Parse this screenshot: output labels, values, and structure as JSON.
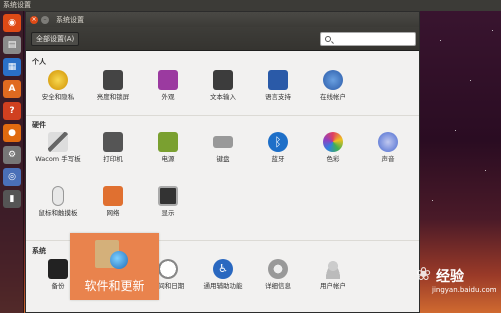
{
  "top_panel": {
    "title": "系统设置"
  },
  "window": {
    "title": "系统设置",
    "all_settings_label": "全部设置(A)",
    "search_placeholder": ""
  },
  "sections": [
    {
      "title": "个人",
      "items": [
        {
          "label": "安全和隐私",
          "icon": "privacy-icon",
          "color": "#f0c020"
        },
        {
          "label": "亮度和锁屏",
          "icon": "lock-icon",
          "color": "#444444"
        },
        {
          "label": "外观",
          "icon": "appearance-icon",
          "color": "#9b3aa0"
        },
        {
          "label": "文本输入",
          "icon": "keyboard-input-icon",
          "color": "#3c3c3c"
        },
        {
          "label": "语言支持",
          "icon": "language-flag-icon",
          "color": "#2a5aa8"
        },
        {
          "label": "在线帐户",
          "icon": "online-accounts-icon",
          "color": "#3c6eb4"
        }
      ]
    },
    {
      "title": "硬件",
      "items": [
        {
          "label": "Wacom 手写板",
          "icon": "wacom-pen-icon",
          "color": "#666666"
        },
        {
          "label": "打印机",
          "icon": "printer-icon",
          "color": "#555555"
        },
        {
          "label": "电源",
          "icon": "power-icon",
          "color": "#7aa030"
        },
        {
          "label": "键盘",
          "icon": "keyboard-icon",
          "color": "#888888"
        },
        {
          "label": "蓝牙",
          "icon": "bluetooth-icon",
          "color": "#1e6fc8"
        },
        {
          "label": "色彩",
          "icon": "color-icon",
          "color": "#e04060"
        },
        {
          "label": "声音",
          "icon": "sound-icon",
          "color": "#4a6ad0"
        },
        {
          "label": "鼠标和触摸板",
          "icon": "mouse-icon",
          "color": "#dddddd"
        },
        {
          "label": "网络",
          "icon": "network-icon",
          "color": "#e07030"
        },
        {
          "label": "显示",
          "icon": "display-icon",
          "color": "#333333"
        }
      ]
    },
    {
      "title": "系统",
      "items": [
        {
          "label": "备份",
          "icon": "backup-icon",
          "color": "#222222"
        },
        {
          "label": "时间和日期",
          "icon": "clock-icon",
          "color": "#888888"
        },
        {
          "label": "通用辅助功能",
          "icon": "accessibility-icon",
          "color": "#2a68c0"
        },
        {
          "label": "详细信息",
          "icon": "gear-icon",
          "color": "#888888"
        },
        {
          "label": "用户帐户",
          "icon": "users-icon",
          "color": "#aaaaaa"
        }
      ]
    }
  ],
  "overlay": {
    "label": "软件和更新",
    "icon": "software-update-icon"
  },
  "watermark": {
    "brand": "经验",
    "url": "jingyan.baidu.com"
  }
}
